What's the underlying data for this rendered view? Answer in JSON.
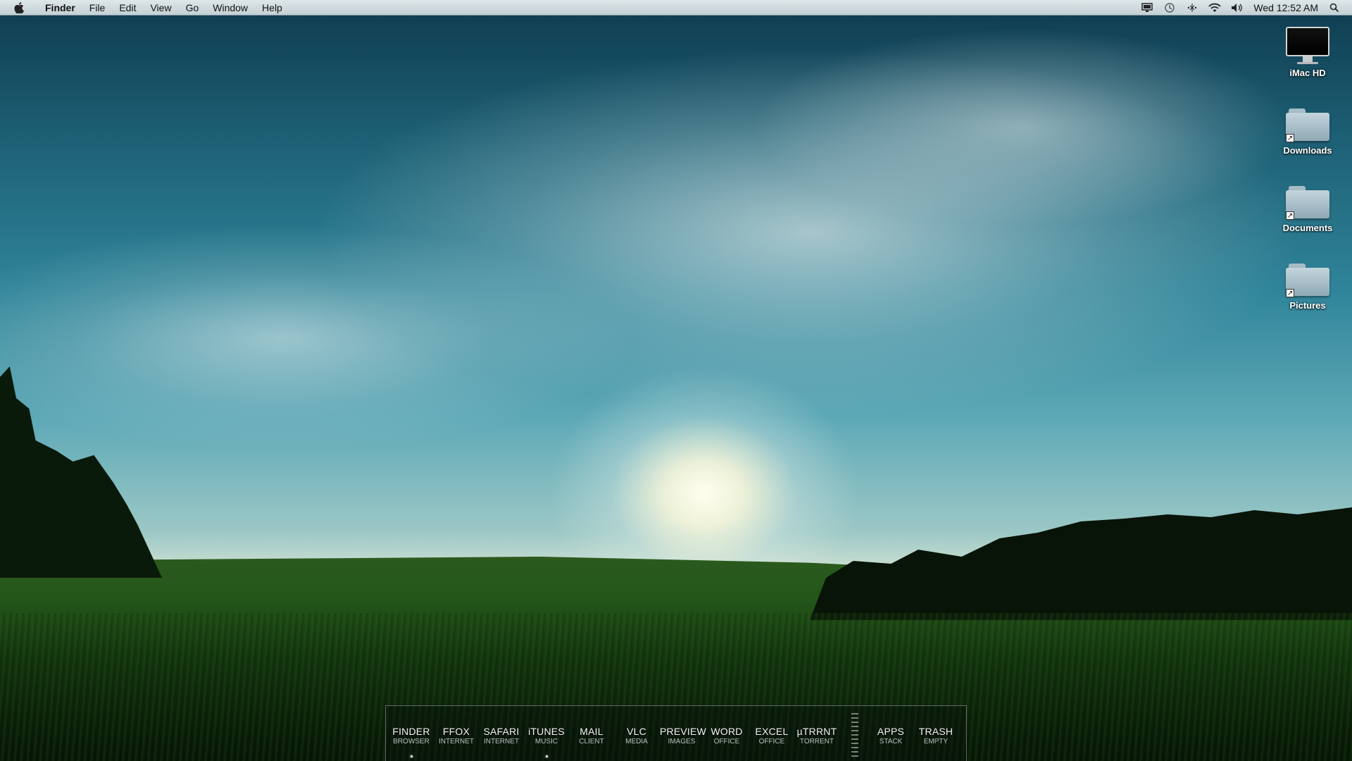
{
  "menubar": {
    "app_name": "Finder",
    "menus": [
      "File",
      "Edit",
      "View",
      "Go",
      "Window",
      "Help"
    ],
    "clock": "Wed 12:52 AM",
    "status_icons": [
      "display-icon",
      "time-machine-icon",
      "bluetooth-icon",
      "wifi-icon",
      "volume-icon",
      "spotlight-icon"
    ]
  },
  "desktop_icons": [
    {
      "label": "iMac HD",
      "icon": "hard-drive-icon"
    },
    {
      "label": "Downloads",
      "icon": "folder-icon"
    },
    {
      "label": "Documents",
      "icon": "folder-icon"
    },
    {
      "label": "Pictures",
      "icon": "folder-icon"
    }
  ],
  "dock": {
    "items": [
      {
        "name": "FINDER",
        "sub": "BROWSER",
        "running": true
      },
      {
        "name": "FFOX",
        "sub": "INTERNET",
        "running": false
      },
      {
        "name": "SAFARI",
        "sub": "INTERNET",
        "running": false
      },
      {
        "name": "iTUNES",
        "sub": "MUSIC",
        "running": true
      },
      {
        "name": "MAIL",
        "sub": "CLIENT",
        "running": false
      },
      {
        "name": "VLC",
        "sub": "MEDIA",
        "running": false
      },
      {
        "name": "PREVIEW",
        "sub": "IMAGES",
        "running": false
      },
      {
        "name": "WORD",
        "sub": "OFFICE",
        "running": false
      },
      {
        "name": "EXCEL",
        "sub": "OFFICE",
        "running": false
      },
      {
        "name": "µTRRNT",
        "sub": "TORRENT",
        "running": false
      },
      {
        "name": "APPS",
        "sub": "STACK",
        "running": false
      },
      {
        "name": "TRASH",
        "sub": "EMPTY",
        "running": false
      }
    ]
  }
}
